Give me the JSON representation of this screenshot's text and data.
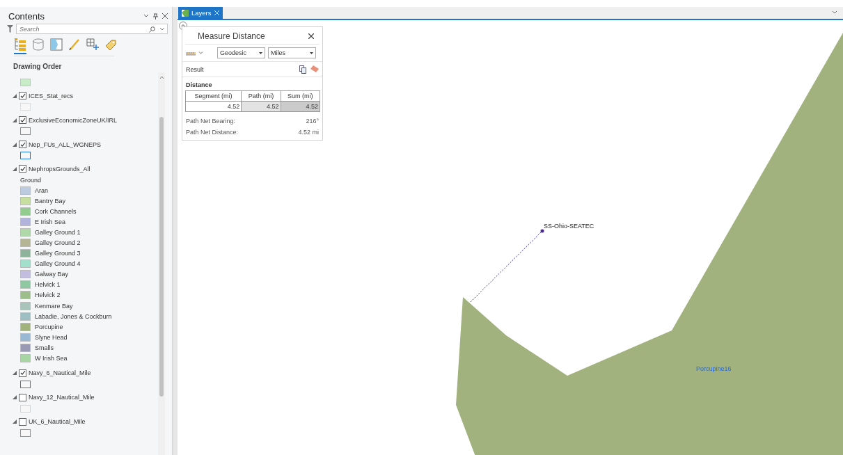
{
  "contents": {
    "title": "Contents",
    "search": {
      "placeholder": "Search"
    },
    "view_tabs": [
      {
        "kind": "drawing-order",
        "selected": true
      },
      {
        "kind": "source",
        "selected": false
      },
      {
        "kind": "selection",
        "selected": false
      },
      {
        "kind": "editing",
        "selected": false
      },
      {
        "kind": "snapping",
        "selected": false
      },
      {
        "kind": "labeling",
        "selected": false
      }
    ],
    "heading": "Drawing Order",
    "layers": [
      {
        "kind": "swatch",
        "color": "#c8ecc8"
      },
      {
        "kind": "layer",
        "name": "ICES_Stat_recs",
        "checked": true,
        "expanded": true,
        "color": "#dcdcdc"
      },
      {
        "kind": "layer",
        "name": "ExclusiveEconomicZoneUK/IRL",
        "checked": true,
        "expanded": true,
        "color": "#8c8c8c"
      },
      {
        "kind": "layer",
        "name": "Nep_FUs_ALL_WGNEPS",
        "checked": true,
        "expanded": true,
        "color": "#1e6ee6"
      },
      {
        "kind": "group",
        "name": "NephropsGrounds_All",
        "checked": true,
        "expanded": true,
        "group_label": "Ground",
        "classes": [
          {
            "name": "Aran",
            "color": "#bdcbe0"
          },
          {
            "name": "Bantry Bay",
            "color": "#c6dfa1"
          },
          {
            "name": "Cork Channels",
            "color": "#93cc8f"
          },
          {
            "name": "E Irish Sea",
            "color": "#b1b3dd"
          },
          {
            "name": "Galley Ground 1",
            "color": "#afd9a8"
          },
          {
            "name": "Galley Ground 2",
            "color": "#b5b595"
          },
          {
            "name": "Galley Ground 3",
            "color": "#8eb29a"
          },
          {
            "name": "Galley Ground 4",
            "color": "#a3e0cc"
          },
          {
            "name": "Galway Bay",
            "color": "#c3bde0"
          },
          {
            "name": "Helvick 1",
            "color": "#8ec8a3"
          },
          {
            "name": "Helvick 2",
            "color": "#9dbd8b"
          },
          {
            "name": "Kenmare Bay",
            "color": "#a7c3ba"
          },
          {
            "name": "Labadie, Jones & Cockburn",
            "color": "#9dbfc4"
          },
          {
            "name": "Porcupine",
            "color": "#a1b27c"
          },
          {
            "name": "Slyne Head",
            "color": "#9ab7d4"
          },
          {
            "name": "Smalls",
            "color": "#9a9ab4"
          },
          {
            "name": "W Irish Sea",
            "color": "#a8d5a4"
          }
        ]
      },
      {
        "kind": "layer",
        "name": "Navy_6_Nautical_Mile",
        "checked": true,
        "expanded": true,
        "color": "#b03cd0"
      },
      {
        "kind": "layer",
        "name": "Navy_12_Nautical_Mile",
        "checked": false,
        "expanded": true,
        "color": "#d4d4d4"
      },
      {
        "kind": "layer",
        "name": "UK_6_Nautical_Mile",
        "checked": false,
        "expanded": true,
        "color": "#b070d0"
      }
    ]
  },
  "map": {
    "tab": {
      "label": "Layers",
      "selected": true
    },
    "measure": {
      "title": "Measure Distance",
      "method": "Geodesic",
      "unit": "Miles",
      "result_label": "Result",
      "distance_heading": "Distance",
      "columns": [
        "Segment (mi)",
        "Path (mi)",
        "Sum (mi)"
      ],
      "values": [
        "4.52",
        "4.52",
        "4.52"
      ],
      "bearing_label": "Path Net Bearing:",
      "bearing": "216°",
      "net_distance_label": "Path Net Distance:",
      "net_distance": "4.52 mi"
    },
    "point_label": "SS-Ohio-SEATEC",
    "polygon_label": "Porcupine16"
  }
}
